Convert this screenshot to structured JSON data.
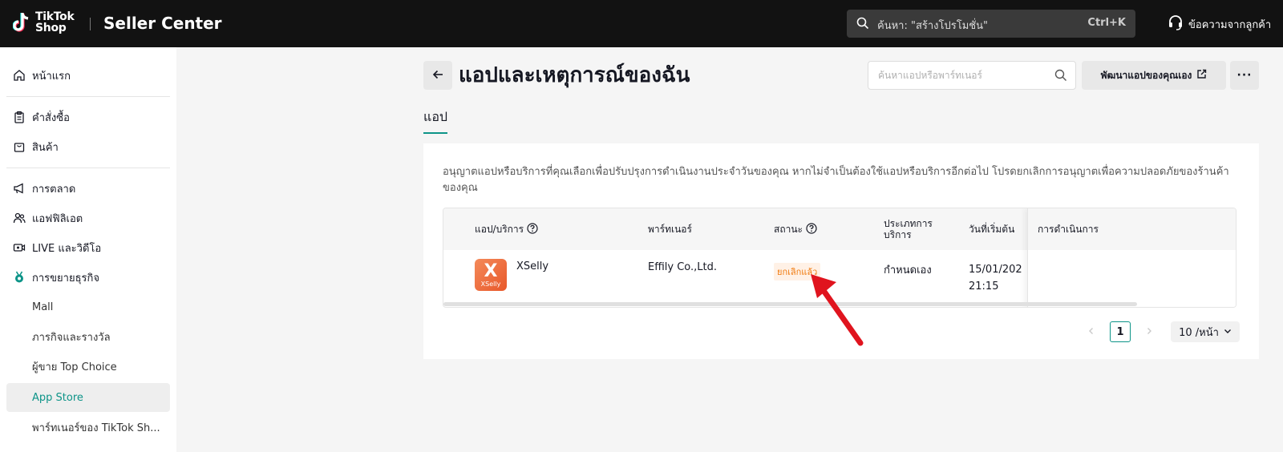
{
  "brand": {
    "logo_line1": "TikTok",
    "logo_line2": "Shop",
    "app_title": "Seller Center"
  },
  "topbar": {
    "search_text": "ค้นหา: \"สร้างโปรโมชั่น\"",
    "search_shortcut": "Ctrl+K",
    "customer_messages": "ข้อความจากลูกค้า"
  },
  "sidebar": {
    "home": "หน้าแรก",
    "orders": "คำสั่งซื้อ",
    "products": "สินค้า",
    "marketing": "การตลาด",
    "affiliate": "แอฟฟิลิเอต",
    "live_video": "LIVE และวิดีโอ",
    "growth": "การขยายธุรกิจ",
    "mall": "Mall",
    "missions": "ภารกิจและรางวัล",
    "top_choice": "ผู้ขาย Top Choice",
    "app_store": "App Store",
    "partners": "พาร์ทเนอร์ของ TikTok Sh..."
  },
  "page": {
    "title": "แอปและเหตุการณ์ของฉัน",
    "search_placeholder": "ค้นหาแอปหรือพาร์ทเนอร์",
    "develop_button": "พัฒนาแอปของคุณเอง",
    "more_button": "···",
    "tab_apps": "แอป",
    "description": "อนุญาตแอปหรือบริการที่คุณเลือกเพื่อปรับปรุงการดำเนินงานประจำวันของคุณ หากไม่จำเป็นต้องใช้แอปหรือบริการอีกต่อไป โปรดยกเลิกการอนุญาตเพื่อความปลอดภัยของร้านค้าของคุณ"
  },
  "table": {
    "headers": {
      "app": "แอป/บริการ",
      "partner": "พาร์ทเนอร์",
      "status": "สถานะ",
      "service_type_1": "ประเภทการ",
      "service_type_2": "บริการ",
      "start_date": "วันที่เริ่มต้น",
      "actions": "การดำเนินการ"
    },
    "rows": [
      {
        "logo_letter": "X",
        "logo_text": "XSelly",
        "app_name": "XSelly",
        "partner": "Effily Co.,Ltd.",
        "status": "ยกเลิกแล้ว",
        "service_type": "กำหนดเอง",
        "start_date": "15/01/202",
        "start_time": "21:15"
      }
    ]
  },
  "pagination": {
    "current_page": "1",
    "page_size": "10 /หน้า"
  },
  "colors": {
    "accent": "#0d9488",
    "status_cancelled": "#f0790c",
    "annotation_arrow": "#e0141e"
  }
}
